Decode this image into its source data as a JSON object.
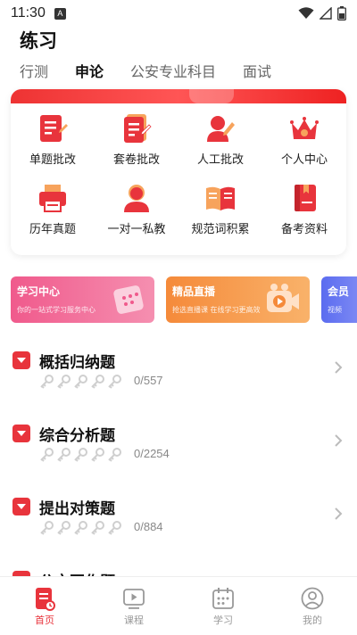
{
  "status_bar": {
    "time": "11:30",
    "notification_glyph": "A"
  },
  "page_title": "练习",
  "tabs": [
    {
      "label": "行测",
      "active": false
    },
    {
      "label": "申论",
      "active": true
    },
    {
      "label": "公安专业科目",
      "active": false
    },
    {
      "label": "面试",
      "active": false
    }
  ],
  "grid_items": [
    {
      "label": "单题批改",
      "icon": "single-correction-icon"
    },
    {
      "label": "套卷批改",
      "icon": "paper-correction-icon"
    },
    {
      "label": "人工批改",
      "icon": "manual-correction-icon"
    },
    {
      "label": "个人中心",
      "icon": "crown-icon"
    },
    {
      "label": "历年真题",
      "icon": "printer-icon"
    },
    {
      "label": "一对一私教",
      "icon": "tutor-icon"
    },
    {
      "label": "规范词积累",
      "icon": "open-book-icon"
    },
    {
      "label": "备考资料",
      "icon": "study-material-icon"
    }
  ],
  "promos": [
    {
      "title": "学习中心",
      "subtitle": "你的一站式学习服务中心"
    },
    {
      "title": "精品直播",
      "subtitle": "抢选直播课 在线学习更高效"
    },
    {
      "title": "会员",
      "subtitle": "视频"
    }
  ],
  "questions": [
    {
      "title": "概括归纳题",
      "progress": "0/557"
    },
    {
      "title": "综合分析题",
      "progress": "0/2254"
    },
    {
      "title": "提出对策题",
      "progress": "0/884"
    },
    {
      "title": "公文写作题",
      "progress": ""
    }
  ],
  "bottom_nav": [
    {
      "label": "首页",
      "active": true
    },
    {
      "label": "课程",
      "active": false
    },
    {
      "label": "学习",
      "active": false
    },
    {
      "label": "我的",
      "active": false
    }
  ],
  "colors": {
    "accent": "#e8343c",
    "inactive": "#999999"
  }
}
